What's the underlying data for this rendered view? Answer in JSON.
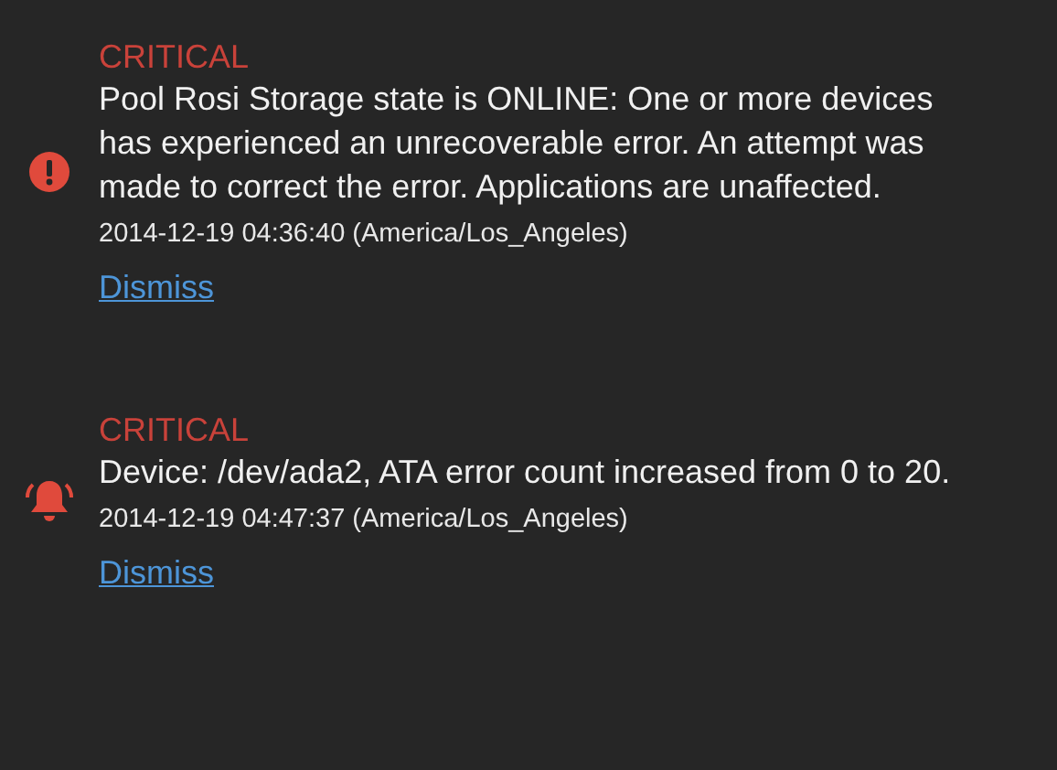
{
  "alerts": [
    {
      "kind": "error",
      "level": "CRITICAL",
      "message": "Pool Rosi Storage state is ONLINE: One or more devices has experienced an unrecoverable error. An attempt was made to correct the error. Applications are unaffected.",
      "timestamp": "2014-12-19 04:36:40 (America/Los_Angeles)",
      "action": "Dismiss"
    },
    {
      "kind": "device",
      "level": "CRITICAL",
      "message": "Device: /dev/ada2, ATA error count increased from 0 to 20.",
      "timestamp": "2014-12-19 04:47:37 (America/Los_Angeles)",
      "action": "Dismiss"
    }
  ]
}
